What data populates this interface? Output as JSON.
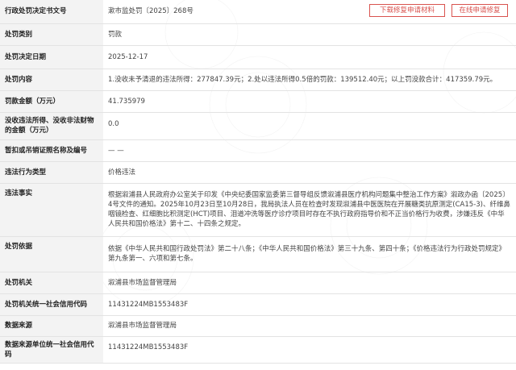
{
  "rows": [
    {
      "label": "行政处罚决定书文号",
      "value": "漱市监处罚〔2025〕268号"
    },
    {
      "label": "处罚类别",
      "value": "罚款"
    },
    {
      "label": "处罚决定日期",
      "value": "2025-12-17"
    },
    {
      "label": "处罚内容",
      "value": "1.没收未予清退的违法所得：277847.39元；2.处以违法所得0.5倍的罚款：139512.40元；以上罚没款合计：417359.79元。"
    },
    {
      "label": "罚款金额（万元）",
      "value": "41.735979"
    },
    {
      "label": "没收违法所得、没收非法财物的金额（万元）",
      "value": "0.0"
    },
    {
      "label": "暂扣或吊销证照名称及编号",
      "value": "— —"
    },
    {
      "label": "违法行为类型",
      "value": "价格违法"
    },
    {
      "label": "违法事实",
      "value": "根据溆浦县人民政府办公室关于印发《中央纪委国家监委第三督导组反馈溆浦县医疗机构问题集中整治工作方案》溆政办函〔2025〕4号文件的通知。2025年10月23日至10月28日，我局执法人员在检查时发现溆浦县中医医院在开展糖类抗原测定(CA15-3)、纤维鼻咽镜检查、红细胞比积测定(HCT)项目、泪道冲洗等医疗诊疗项目时存在不执行政府指导价和不正当价格行为收费，涉嫌违反《中华人民共和国价格法》第十二、十四条之规定。"
    },
    {
      "label": "处罚依据",
      "value": "依据《中华人民共和国行政处罚法》第二十八条；《中华人民共和国价格法》第三十九条、第四十条；《价格违法行为行政处罚规定》第九条第一、六项和第七条。"
    },
    {
      "label": "处罚机关",
      "value": "溆浦县市场监督管理局"
    },
    {
      "label": "处罚机关统一社会信用代码",
      "value": "11431224MB1553483F"
    },
    {
      "label": "数据来源",
      "value": "溆浦县市场监督管理局"
    },
    {
      "label": "数据来源单位统一社会信用代码",
      "value": "11431224MB1553483F"
    }
  ],
  "buttons": {
    "download": "下载修复申请材料",
    "online": "在线申请修复"
  },
  "colors": {
    "label_bg": "#f3f3f3",
    "border": "#e3e3e3",
    "button": "#d9534f"
  }
}
